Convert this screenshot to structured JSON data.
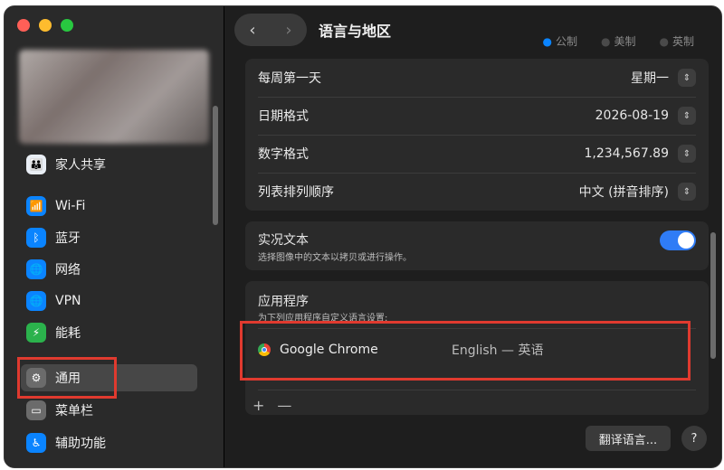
{
  "window": {
    "title": "语言与地区"
  },
  "header": {
    "back_icon": "chevron-left-icon",
    "forward_icon": "chevron-right-icon"
  },
  "measurement": {
    "options": [
      "公制",
      "美制",
      "英制"
    ],
    "selected": "公制"
  },
  "sidebar": {
    "family_sharing": "家人共享",
    "items": [
      {
        "label": "Wi-Fi",
        "icon": "wifi-icon"
      },
      {
        "label": "蓝牙",
        "icon": "bluetooth-icon"
      },
      {
        "label": "网络",
        "icon": "globe-icon"
      },
      {
        "label": "VPN",
        "icon": "vpn-icon"
      },
      {
        "label": "能耗",
        "icon": "battery-icon"
      },
      {
        "label": "通用",
        "icon": "gear-icon",
        "active": true
      },
      {
        "label": "菜单栏",
        "icon": "menubar-icon"
      },
      {
        "label": "辅助功能",
        "icon": "accessibility-icon"
      }
    ]
  },
  "formats": {
    "rows": [
      {
        "label": "每周第一天",
        "value": "星期一"
      },
      {
        "label": "日期格式",
        "value": "2026-08-19"
      },
      {
        "label": "数字格式",
        "value": "1,234,567.89"
      },
      {
        "label": "列表排列顺序",
        "value": "中文 (拼音排序)"
      }
    ]
  },
  "live_text": {
    "title": "实况文本",
    "subtitle": "选择图像中的文本以拷贝或进行操作。"
  },
  "apps": {
    "title": "应用程序",
    "subtitle": "为下列应用程序自定义语言设置:",
    "entries": [
      {
        "name": "Google Chrome",
        "language": "English — 英语"
      }
    ],
    "add": "+",
    "remove": "—"
  },
  "footer": {
    "translate_button": "翻译语言...",
    "help_button": "?"
  },
  "colors": {
    "accent": "#0a84ff",
    "highlight_box": "#e03a2f"
  }
}
